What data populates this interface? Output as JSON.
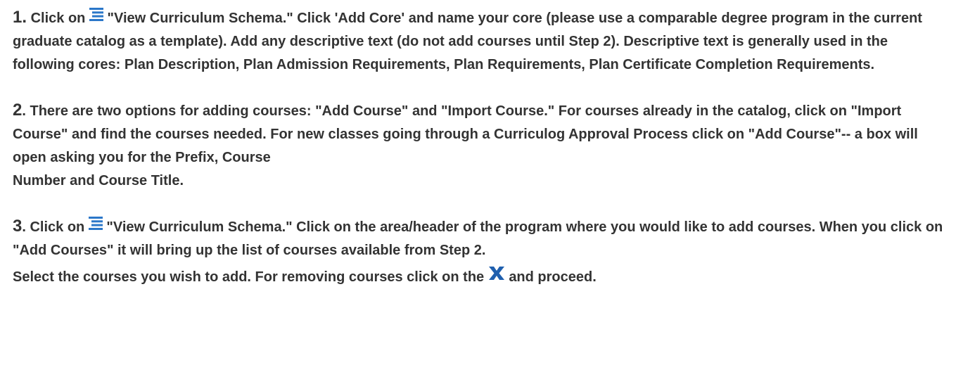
{
  "steps": [
    {
      "number": "1.",
      "before_icon": "Click on",
      "icon": "schema-list-icon",
      "after_icon": "\"View Curriculum Schema.\" Click 'Add Core' and name your core (please use a comparable degree program in the current graduate catalog as a template). Add any descriptive text (do not add courses until Step 2). Descriptive text is generally used in the following cores: Plan Description, Plan Admission Requirements, Plan Requirements, Plan Certificate Completion Requirements."
    },
    {
      "number": "2",
      "text_1": ". There are two options for adding courses: \"Add Course\" and \"Import Course.\" For courses already in the catalog, click on \"Import Course\" and find the courses needed. For new classes going through a Curriculog Approval Process click on \"Add Course\"-- a box will open asking you for the Prefix, Course",
      "text_2": "Number and Course Title."
    },
    {
      "number": "3",
      "before_icon": ". Click on",
      "icon": "schema-list-icon",
      "after_icon": "\"View Curriculum Schema.\" Click on the area/header of the program where you would like to add courses. When you click on \"Add Courses\" it will bring up the list of courses available from Step 2.",
      "line_3_before_icon": "Select the courses you wish to add. For removing courses click on the",
      "line_3_icon": "remove-x-icon",
      "line_3_after_icon": "and proceed."
    }
  ],
  "colors": {
    "text": "#333333",
    "icon_blue": "#2b77c9"
  }
}
